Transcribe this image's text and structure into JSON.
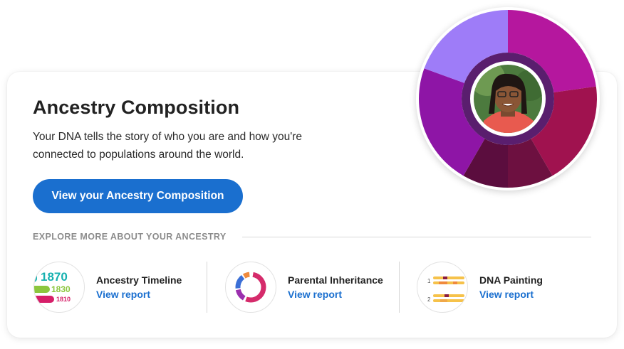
{
  "hero": {
    "title": "Ancestry Composition",
    "description": "Your DNA tells the story of who you are and how you're connected to populations around the world.",
    "cta_label": "View your Ancestry Composition"
  },
  "explore": {
    "label": "EXPLORE MORE ABOUT YOUR ANCESTRY",
    "reports": [
      {
        "name": "Ancestry Timeline",
        "link": "View report",
        "icon": "ancestry-timeline-thumbnail"
      },
      {
        "name": "Parental Inheritance",
        "link": "View report",
        "icon": "parental-inheritance-thumbnail"
      },
      {
        "name": "DNA Painting",
        "link": "View report",
        "icon": "dna-painting-thumbnail"
      }
    ]
  },
  "timeline_thumb": {
    "years": [
      "1870",
      "1830",
      "1810"
    ],
    "colors": [
      "#16b1b0",
      "#8cc63e",
      "#d61f69"
    ]
  },
  "dna_thumb": {
    "row_labels": [
      "1",
      "2"
    ]
  },
  "colors": {
    "accent": "#1a6fcf",
    "donut_segments": [
      "#b5179e",
      "#a0124f",
      "#6d1040",
      "#5b0d3e",
      "#8e15a6",
      "#9e7cf8"
    ],
    "donut_inner_ring": "#5a1e6e"
  }
}
